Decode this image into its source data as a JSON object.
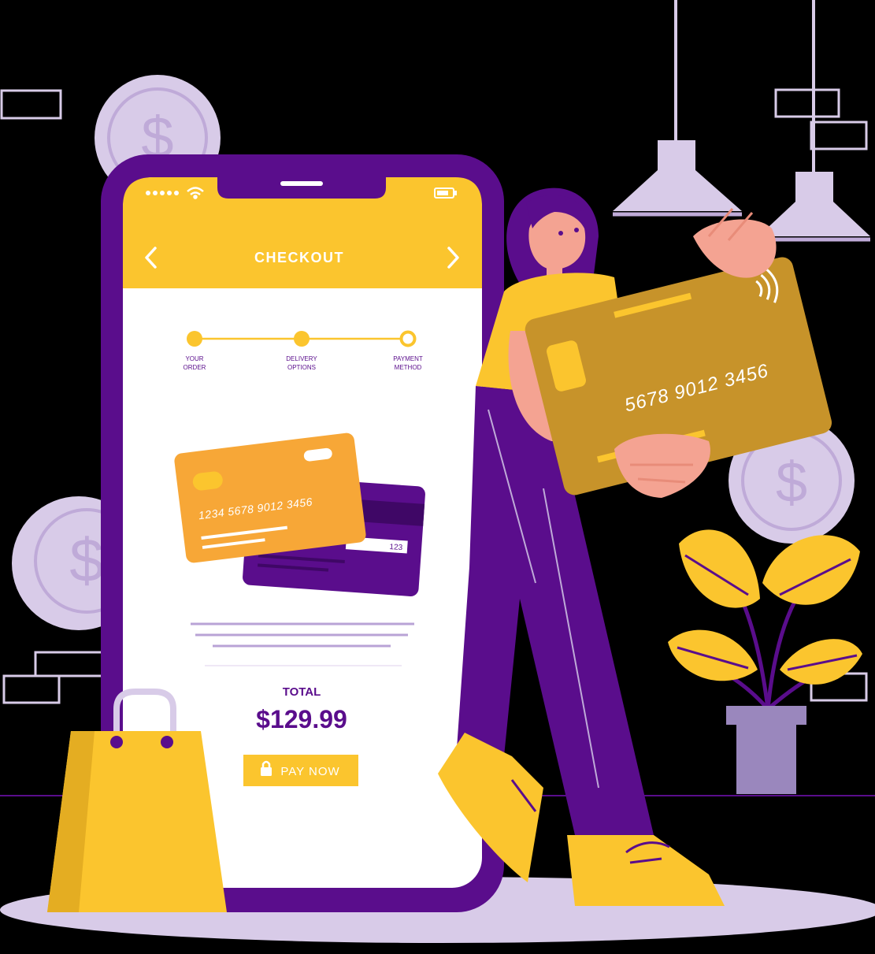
{
  "colors": {
    "background": "#000000",
    "purple": "#5a0d8c",
    "yellow": "#fbc52e",
    "lavender": "#d8cbe8",
    "orange_card": "#f7a737",
    "gold_card": "#c7932a",
    "skin": "#f4a392",
    "white": "#ffffff"
  },
  "icons": {
    "back": "chevron-left-icon",
    "forward": "chevron-right-icon",
    "signal": "signal-dots-icon",
    "wifi": "wifi-icon",
    "battery": "battery-icon",
    "lock": "lock-icon",
    "contactless": "contactless-icon",
    "coin": "dollar-coin-icon",
    "bag": "shopping-bag-icon",
    "lamp": "pendant-lamp-icon",
    "plant": "potted-plant-icon"
  },
  "checkout": {
    "title": "CHECKOUT",
    "steps": [
      {
        "line1": "YOUR",
        "line2": "ORDER",
        "state": "done"
      },
      {
        "line1": "DELIVERY",
        "line2": "OPTIONS",
        "state": "done"
      },
      {
        "line1": "PAYMENT",
        "line2": "METHOD",
        "state": "current"
      }
    ],
    "front_card_number": "1234  5678  9012  3456",
    "back_card_cvv": "123",
    "total_label": "TOTAL",
    "total_amount": "$129.99",
    "pay_button": "PAY NOW"
  },
  "held_card": {
    "number": "5678  9012  3456"
  }
}
